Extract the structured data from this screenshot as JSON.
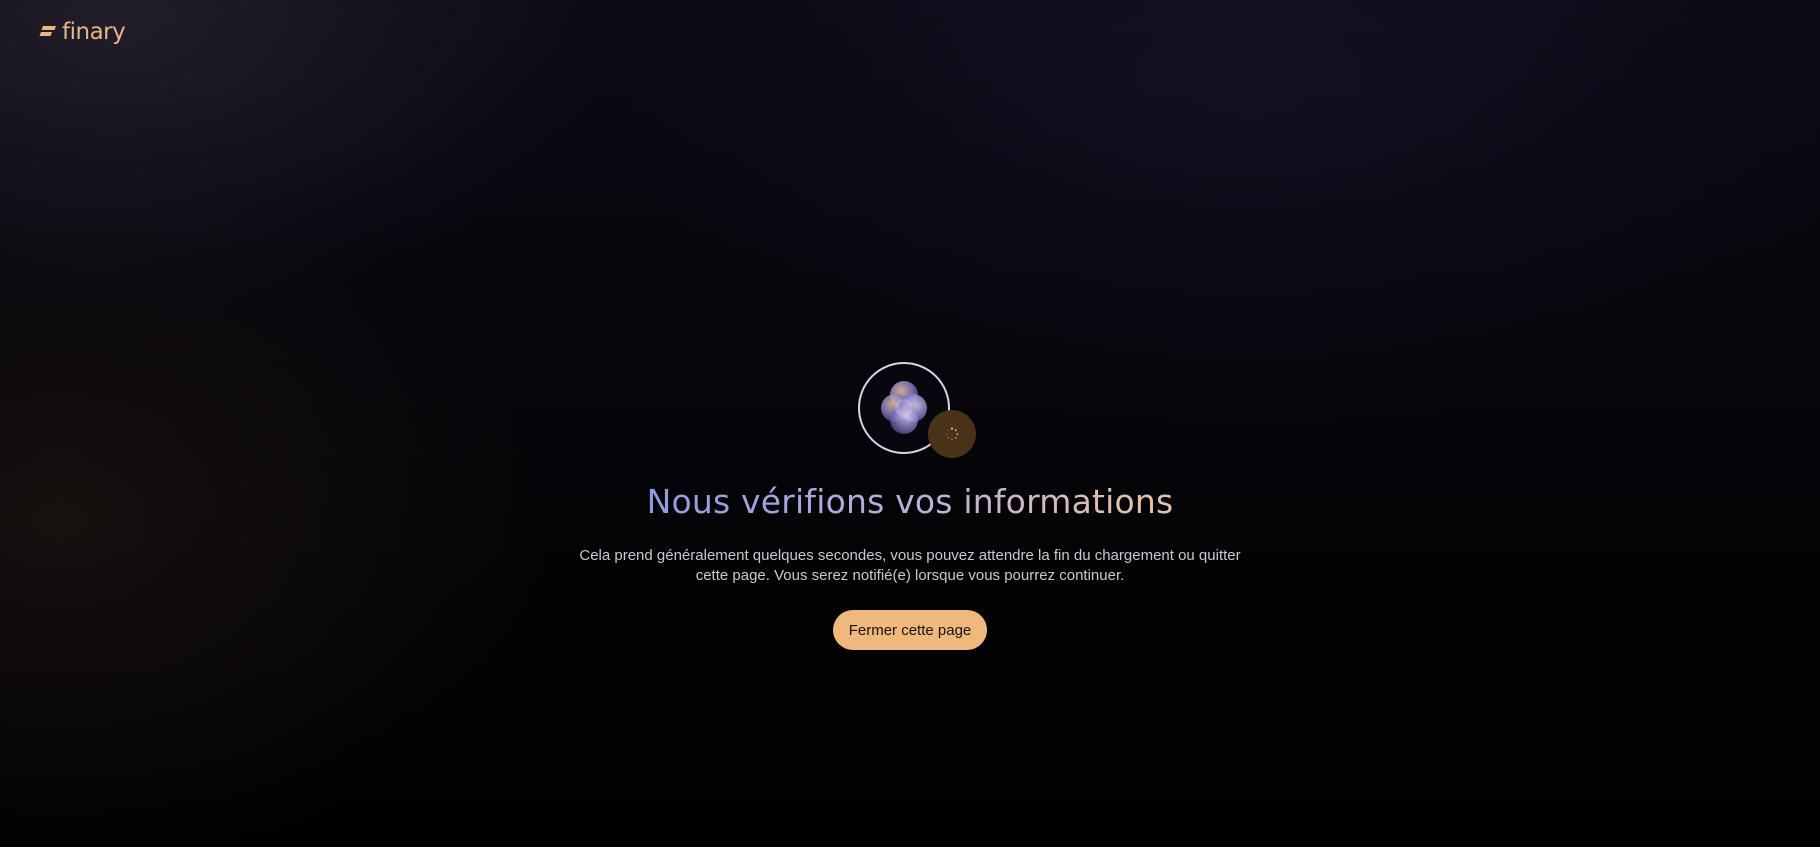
{
  "brand": {
    "name": "finary",
    "logo_icon": "finary-logo-icon",
    "color": "#e9b67f"
  },
  "verification": {
    "title": "Nous vérifions vos informations",
    "description_line1": "Cela prend généralement quelques secondes, vous pouvez attendre la fin du chargement ou quitter",
    "description_line2": "cette page. Vous serez notifié(e) lorsque vous pourrez continuer.",
    "close_button_label": "Fermer cette page",
    "avatar_icon": "orb-avatar-icon",
    "status_icon": "loading-spinner-icon"
  },
  "colors": {
    "accent": "#f0b97c",
    "background": "#020205",
    "title_gradient_start": "#8f9ae0",
    "title_gradient_end": "#e8c4a2",
    "loader_badge": "#4a3218"
  }
}
